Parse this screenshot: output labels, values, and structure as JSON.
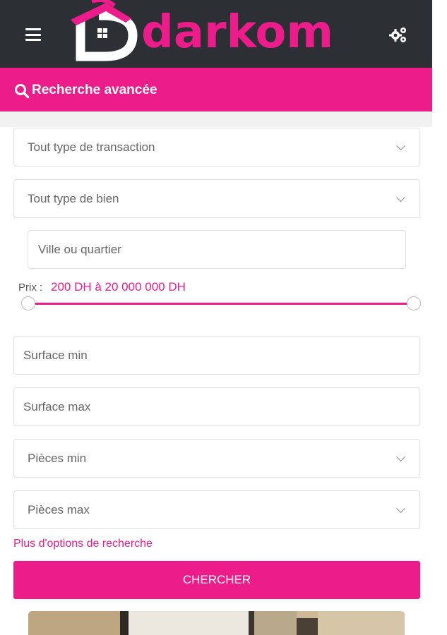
{
  "header": {
    "logo_text": "darkom",
    "menu_icon": "hamburger-menu-icon",
    "settings_icon": "gears-icon"
  },
  "advanced_search": {
    "label": "Recherche avancée",
    "icon": "search-icon"
  },
  "form": {
    "transaction_type": "Tout type de transaction",
    "property_type": "Tout type de bien",
    "city_placeholder": "Ville ou quartier",
    "price_label": "Prix :",
    "price_range": "200 DH à 20 000 000 DH",
    "surface_min_placeholder": "Surface min",
    "surface_max_placeholder": "Surface max",
    "rooms_min": "Pièces min",
    "rooms_max": "Pièces max",
    "more_options": "Plus d'options de recherche",
    "submit": "CHERCHER"
  },
  "colors": {
    "brand": "#ec1c8a",
    "header_bg": "#2c3035"
  }
}
